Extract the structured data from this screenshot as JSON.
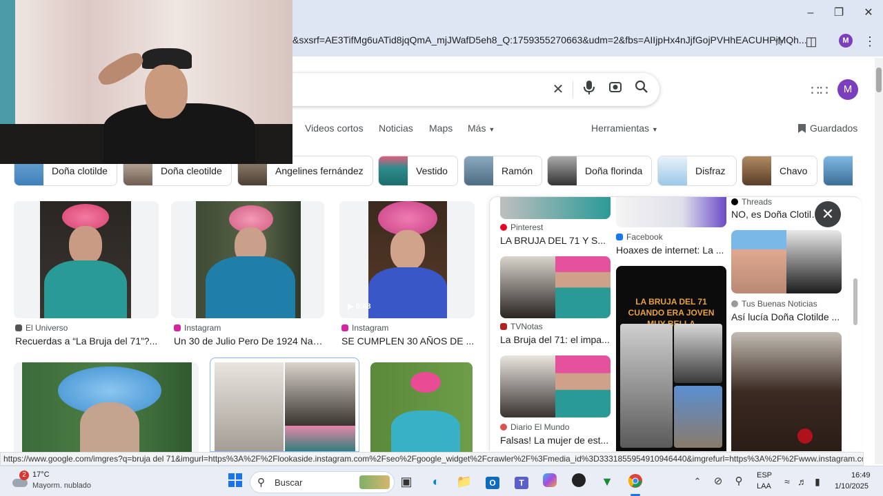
{
  "browser": {
    "url": "&sxsrf=AE3TifMg6uATid8jqQmA_mjJWafD5eh8_Q:1759355270663&udm=2&fbs=AIIjpHx4nJjfGojPVHhEACUHPiMQh...",
    "profile_initial": "M",
    "status_url": "https://www.google.com/imgres?q=bruja del 71&imgurl=https%3A%2F%2Flookaside.instagram.com%2Fseo%2Fgoogle_widget%2Fcrawler%2F%3Fmedia_id%3D3331855954910946440&imgrefurl=https%3A%2F%2Fwww.instagram.com%2Freel%2FC..."
  },
  "search": {
    "profile_initial": "M"
  },
  "tabs": [
    "Videos cortos",
    "Noticias",
    "Maps",
    "Más",
    "Herramientas",
    "Guardados"
  ],
  "chips": [
    {
      "label": "Doña clotilde",
      "color": "#5b9bd5"
    },
    {
      "label": "Doña cleotilde",
      "color": "#a08c7a"
    },
    {
      "label": "Angelines fernández",
      "color": "#7a6a5a"
    },
    {
      "label": "Vestido",
      "color": "#2d7d7d"
    },
    {
      "label": "Ramón",
      "color": "#6b8fa8"
    },
    {
      "label": "Doña florinda",
      "color": "#555555"
    },
    {
      "label": "Disfraz",
      "color": "#b9d7ec"
    },
    {
      "label": "Chavo",
      "color": "#8a6a4a"
    },
    {
      "label": "",
      "color": "#6aa7d8"
    }
  ],
  "results": [
    {
      "source": "El Universo",
      "title": "Recuerdas a “La Bruja del 71”?...",
      "fav": "#555"
    },
    {
      "source": "Instagram",
      "title": "Un 30 de Julio Pero De 1924 Nac...",
      "fav": "#d6249f"
    },
    {
      "source": "Instagram",
      "title": "SE CUMPLEN 30 AÑOS DE ...",
      "fav": "#d6249f",
      "duration": "0:48"
    }
  ],
  "panel": {
    "col1": [
      {
        "source": "Pinterest",
        "title": "LA BRUJA DEL 71 Y S...",
        "fav": "#e60023"
      },
      {
        "source": "TVNotas",
        "title": "La Bruja del 71: el impa...",
        "fav": "#b22222"
      },
      {
        "source": "Diario El Mundo",
        "title": "Falsas! La mujer de est...",
        "fav": "#d9534f"
      }
    ],
    "col2": [
      {
        "source": "Facebook",
        "title": "Hoaxes de internet: La ...",
        "fav": "#1877f2"
      }
    ],
    "col2_image_text": "LA BRUJA DEL 71 CUANDO ERA JOVEN MUY BELLA",
    "col3": [
      {
        "source": "Threads",
        "title": "NO, es Doña Clotilde",
        "fav": "#000"
      },
      {
        "source": "Tus Buenas Noticias",
        "title": "Así lucía Doña Clotilde ...",
        "fav": "#888"
      }
    ]
  },
  "taskbar": {
    "weather_temp": "17°C",
    "weather_desc": "Mayorm. nublado",
    "weather_badge": "2",
    "search_label": "Buscar",
    "lang": "ESP",
    "lang_sub": "LAA",
    "time": "16:49",
    "date": "1/10/2025"
  }
}
